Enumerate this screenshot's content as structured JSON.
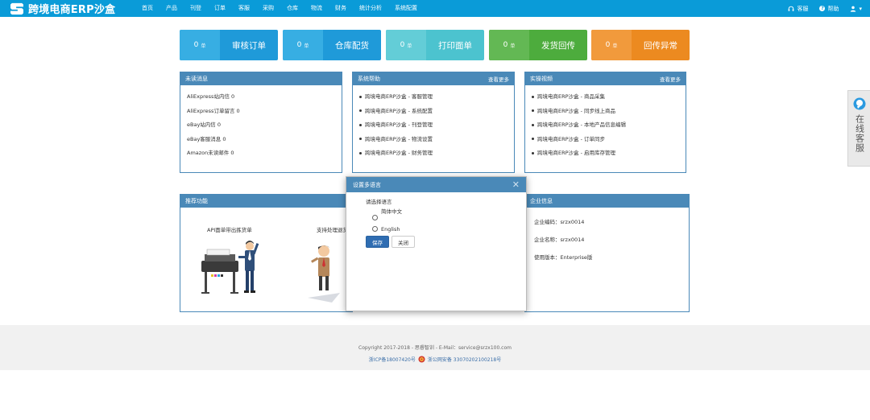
{
  "app": {
    "title": "跨境电商ERP沙盒"
  },
  "nav": {
    "items": [
      "首页",
      "产品",
      "刊登",
      "订单",
      "客服",
      "采购",
      "仓库",
      "物流",
      "财务",
      "统计分析",
      "系统配置"
    ],
    "right": {
      "service": "客服",
      "help": "帮助",
      "user_caret": "▾"
    }
  },
  "tiles": [
    {
      "count": "0",
      "unit": "单",
      "label": "审核订单",
      "color": "#1f9ad9",
      "count_color": "#37aee3"
    },
    {
      "count": "0",
      "unit": "单",
      "label": "仓库配货",
      "color": "#1f9ad9",
      "count_color": "#37aee3"
    },
    {
      "count": "0",
      "unit": "单",
      "label": "打印面单",
      "color": "#4cc3cf",
      "count_color": "#63cdd7"
    },
    {
      "count": "0",
      "unit": "单",
      "label": "发货回传",
      "color": "#4dac3d",
      "count_color": "#63b854"
    },
    {
      "count": "0",
      "unit": "单",
      "label": "回传异常",
      "color": "#ec8a20",
      "count_color": "#f19a3c"
    }
  ],
  "panels": {
    "unread": {
      "title": "未读消息",
      "items": [
        "AliExpress站内信 0",
        "AliExpress订单留言 0",
        "eBay站内信 0",
        "eBay客服消息 0",
        "Amazon未读邮件 0"
      ]
    },
    "help": {
      "title": "系统帮助",
      "more": "查看更多",
      "items": [
        "跨境电商ERP沙盒 - 客服管理",
        "跨境电商ERP沙盒 - 系统配置",
        "跨境电商ERP沙盒 - 刊登管理",
        "跨境电商ERP沙盒 - 物流设置",
        "跨境电商ERP沙盒 - 财务管理"
      ]
    },
    "video": {
      "title": "实操视频",
      "more": "查看更多",
      "items": [
        "跨境电商ERP沙盒 - 商品采集",
        "跨境电商ERP沙盒 - 同步线上商品",
        "跨境电商ERP沙盒 - 本地产品信息编辑",
        "跨境电商ERP沙盒 - 订单同步",
        "跨境电商ERP沙盒 - 启用库存管理"
      ]
    },
    "recommend": {
      "title": "推荐功能",
      "feature1": "API面单带出拣货单",
      "feature2": "支持处理退货"
    },
    "company": {
      "title": "企业信息",
      "code": "企业编码：srzx0014",
      "name": "企业名称：srzx0014",
      "version": "使用版本：Enterprise版"
    }
  },
  "modal": {
    "title": "设置多语言",
    "prompt": "请选择语言",
    "options": [
      "简体中文",
      "English"
    ],
    "save": "保存",
    "close": "关闭"
  },
  "footer": {
    "copyright": "Copyright 2017-2018 - 思睿智训 - E-Mail：service@srzx100.com",
    "icp": "浙ICP备18007420号",
    "police": "浙公网安备 33070202100218号"
  },
  "float_service": {
    "label": "在线客服"
  }
}
